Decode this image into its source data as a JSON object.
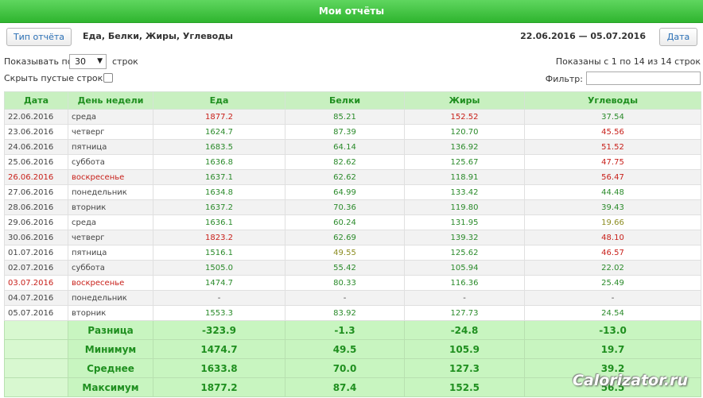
{
  "header": {
    "title": "Мои отчёты"
  },
  "toolbar": {
    "report_type_label": "Тип отчёта",
    "categories": "Еда, Белки, Жиры, Углеводы",
    "date_range": "22.06.2016 — 05.07.2016",
    "date_button_label": "Дата"
  },
  "controls": {
    "show_prefix": "Показывать по",
    "page_size": "30",
    "show_suffix": "строк",
    "hide_empty_label": "Скрыть пустые строки:",
    "shown_info": "Показаны с 1 по 14 из 14 строк",
    "filter_label": "Фильтр:",
    "filter_value": ""
  },
  "table": {
    "headers": [
      "Дата",
      "День недели",
      "Еда",
      "Белки",
      "Жиры",
      "Углеводы"
    ],
    "rows": [
      {
        "date": "22.06.2016",
        "day": "среда",
        "food": "1877.2",
        "prot": "85.21",
        "fat": "152.52",
        "carb": "37.54",
        "cls": [
          "dark",
          "dark",
          "red",
          "green",
          "red",
          "green"
        ]
      },
      {
        "date": "23.06.2016",
        "day": "четверг",
        "food": "1624.7",
        "prot": "87.39",
        "fat": "120.70",
        "carb": "45.56",
        "cls": [
          "dark",
          "dark",
          "green",
          "green",
          "green",
          "red"
        ]
      },
      {
        "date": "24.06.2016",
        "day": "пятница",
        "food": "1683.5",
        "prot": "64.14",
        "fat": "136.92",
        "carb": "51.52",
        "cls": [
          "dark",
          "dark",
          "green",
          "green",
          "green",
          "red"
        ]
      },
      {
        "date": "25.06.2016",
        "day": "суббота",
        "food": "1636.8",
        "prot": "82.62",
        "fat": "125.67",
        "carb": "47.75",
        "cls": [
          "dark",
          "dark",
          "green",
          "green",
          "green",
          "red"
        ]
      },
      {
        "date": "26.06.2016",
        "day": "воскресенье",
        "food": "1637.1",
        "prot": "62.62",
        "fat": "118.91",
        "carb": "56.47",
        "cls": [
          "red",
          "red",
          "green",
          "green",
          "green",
          "red"
        ]
      },
      {
        "date": "27.06.2016",
        "day": "понедельник",
        "food": "1634.8",
        "prot": "64.99",
        "fat": "133.42",
        "carb": "44.48",
        "cls": [
          "dark",
          "dark",
          "green",
          "green",
          "green",
          "green"
        ]
      },
      {
        "date": "28.06.2016",
        "day": "вторник",
        "food": "1637.2",
        "prot": "70.36",
        "fat": "119.80",
        "carb": "39.43",
        "cls": [
          "dark",
          "dark",
          "green",
          "green",
          "green",
          "green"
        ]
      },
      {
        "date": "29.06.2016",
        "day": "среда",
        "food": "1636.1",
        "prot": "60.24",
        "fat": "131.95",
        "carb": "19.66",
        "cls": [
          "dark",
          "dark",
          "green",
          "green",
          "green",
          "olive"
        ]
      },
      {
        "date": "30.06.2016",
        "day": "четверг",
        "food": "1823.2",
        "prot": "62.69",
        "fat": "139.32",
        "carb": "48.10",
        "cls": [
          "dark",
          "dark",
          "red",
          "green",
          "green",
          "red"
        ]
      },
      {
        "date": "01.07.2016",
        "day": "пятница",
        "food": "1516.1",
        "prot": "49.55",
        "fat": "125.62",
        "carb": "46.57",
        "cls": [
          "dark",
          "dark",
          "green",
          "olive",
          "green",
          "red"
        ]
      },
      {
        "date": "02.07.2016",
        "day": "суббота",
        "food": "1505.0",
        "prot": "55.42",
        "fat": "105.94",
        "carb": "22.02",
        "cls": [
          "dark",
          "dark",
          "green",
          "green",
          "green",
          "green"
        ]
      },
      {
        "date": "03.07.2016",
        "day": "воскресенье",
        "food": "1474.7",
        "prot": "80.33",
        "fat": "116.36",
        "carb": "25.49",
        "cls": [
          "red",
          "red",
          "green",
          "green",
          "green",
          "green"
        ]
      },
      {
        "date": "04.07.2016",
        "day": "понедельник",
        "food": "-",
        "prot": "-",
        "fat": "-",
        "carb": "-",
        "cls": [
          "dark",
          "dark",
          "dark",
          "dark",
          "dark",
          "dark"
        ]
      },
      {
        "date": "05.07.2016",
        "day": "вторник",
        "food": "1553.3",
        "prot": "83.92",
        "fat": "127.73",
        "carb": "24.54",
        "cls": [
          "dark",
          "dark",
          "green",
          "green",
          "green",
          "green"
        ]
      }
    ],
    "summary": [
      {
        "label": "Разница",
        "food": "-323.9",
        "prot": "-1.3",
        "fat": "-24.8",
        "carb": "-13.0"
      },
      {
        "label": "Минимум",
        "food": "1474.7",
        "prot": "49.5",
        "fat": "105.9",
        "carb": "19.7"
      },
      {
        "label": "Среднее",
        "food": "1633.8",
        "prot": "70.0",
        "fat": "127.3",
        "carb": "39.2"
      },
      {
        "label": "Максимум",
        "food": "1877.2",
        "prot": "87.4",
        "fat": "152.5",
        "carb": "56.5"
      }
    ]
  },
  "watermark": "Calorizator.ru"
}
